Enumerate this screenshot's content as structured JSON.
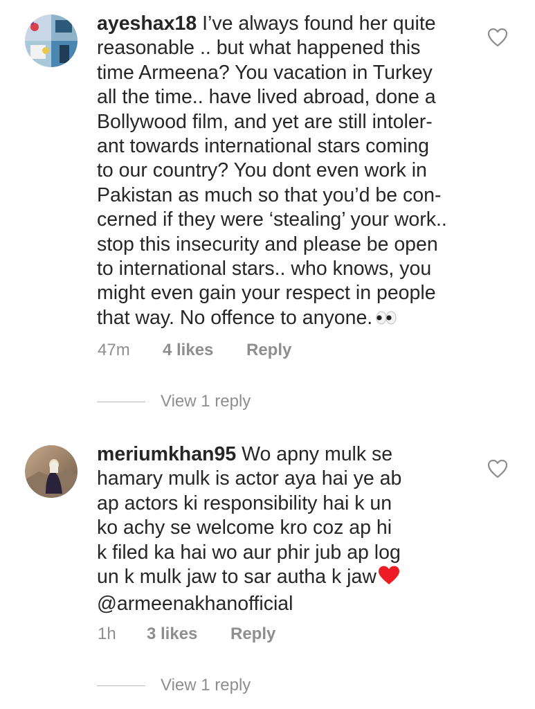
{
  "comments": [
    {
      "username": "ayeshax18",
      "lines": [
        "I’ve always found her quite",
        "reasonable .. but what happened this",
        "time Armeena? You vacation in Turkey",
        "all the time.. have lived abroad, done a",
        "Bollywood film, and yet are still intoler-",
        "ant towards international stars coming",
        "to our country? You dont even work in",
        "Pakistan as much so that you’d be con-",
        "cerned if they were ‘stealing’ your work..",
        "stop this insecurity and please be open",
        "to international stars.. who knows, you",
        "might even gain your respect in people",
        "that way. No offence to anyone."
      ],
      "trailing_emoji": "eyes-emoji",
      "time": "47m",
      "likes": "4 likes",
      "reply_label": "Reply",
      "view_replies_label": "View 1 reply",
      "liked": false
    },
    {
      "username": "meriumkhan95",
      "lines": [
        "Wo apny mulk se",
        "hamary mulk is actor aya hai ye ab",
        "ap actors ki responsibility hai k un",
        "ko achy se welcome kro coz ap hi",
        "k filed ka hai wo aur phir  jub ap log",
        "un k mulk jaw to sar autha k jaw",
        "@armeenakhanofficial"
      ],
      "trailing_emoji": "red-heart-emoji",
      "time": "1h",
      "likes": "3 likes",
      "reply_label": "Reply",
      "view_replies_label": "View 1 reply",
      "liked": false
    }
  ],
  "icons": {
    "like": "heart-outline-icon"
  },
  "colors": {
    "text": "#262626",
    "secondary": "#8e8e8e",
    "heart": "#ed1c24",
    "divider": "#b8b8b8"
  }
}
